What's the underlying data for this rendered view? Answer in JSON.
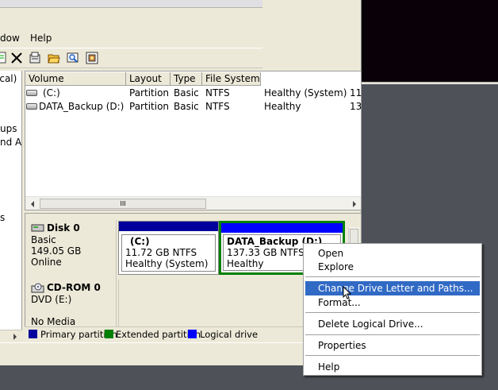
{
  "menu": {
    "items": [
      "dow",
      "Help"
    ]
  },
  "toolbar": {
    "icons": [
      "properties-icon",
      "delete-icon",
      "properties-sheet-icon",
      "open-folder-icon",
      "search-icon",
      "refresh-icon"
    ]
  },
  "left_pane": {
    "lines": [
      "ocal)",
      "ups",
      "nd A",
      "s"
    ]
  },
  "volume_list": {
    "columns": [
      "Volume",
      "Layout",
      "Type",
      "File System"
    ],
    "rows": [
      {
        "volume": "(C:)",
        "layout": "Partition",
        "type": "Basic",
        "fs": "NTFS",
        "status": "Healthy (System)",
        "extra": "11"
      },
      {
        "volume": "DATA_Backup (D:)",
        "layout": "Partition",
        "type": "Basic",
        "fs": "NTFS",
        "status": "Healthy",
        "extra": "13"
      }
    ],
    "scroll_thumb": "III"
  },
  "disks": [
    {
      "name": "Disk 0",
      "type": "Basic",
      "size": "149.05 GB",
      "status": "Online",
      "partitions": [
        {
          "name": "(C:)",
          "size": "11.72 GB NTFS",
          "status": "Healthy (System)"
        },
        {
          "name": "DATA_Backup  (D:)",
          "size": "137.33 GB NTFS",
          "status": "Healthy"
        }
      ]
    },
    {
      "name": "CD-ROM 0",
      "type": "DVD (E:)",
      "status": "No Media"
    }
  ],
  "legend": {
    "items": [
      {
        "label": "Primary partition",
        "color": "#00009c"
      },
      {
        "label": "Extended partition",
        "color": "#008000"
      },
      {
        "label": "Logical drive",
        "color": "#0000ff"
      }
    ]
  },
  "context_menu": {
    "items": [
      {
        "label": "Open"
      },
      {
        "label": "Explore"
      },
      {
        "label": "Change Drive Letter and Paths...",
        "selected": true
      },
      {
        "label": "Format..."
      },
      {
        "label": "Delete Logical Drive..."
      },
      {
        "label": "Properties"
      },
      {
        "label": "Help"
      }
    ]
  },
  "colors": {
    "primary": "#00009c",
    "extended": "#008000",
    "logical": "#0000ff",
    "selection": "#316ac5"
  }
}
